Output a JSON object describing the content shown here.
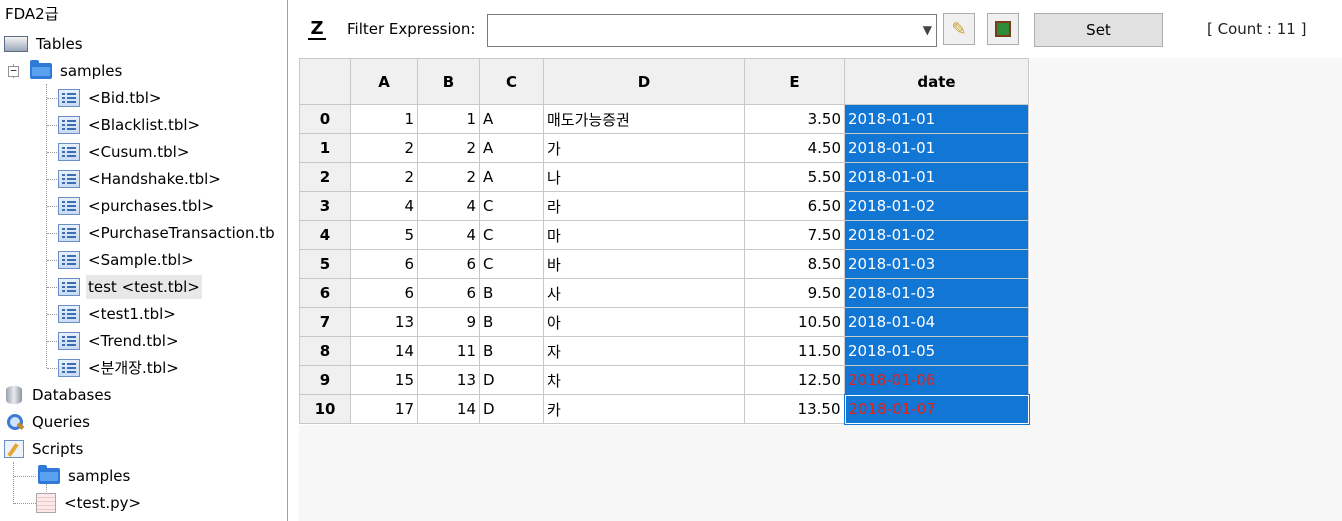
{
  "tree": {
    "root_label": "FDA2급",
    "tables_label": "Tables",
    "samples_label": "samples",
    "tables": [
      "<Bid.tbl>",
      "<Blacklist.tbl>",
      "<Cusum.tbl>",
      "<Handshake.tbl>",
      "<purchases.tbl>",
      "<PurchaseTransaction.tb",
      "<Sample.tbl>",
      "test <test.tbl>",
      "<test1.tbl>",
      "<Trend.tbl>",
      "<분개장.tbl>"
    ],
    "selected_index": 7,
    "databases_label": "Databases",
    "queries_label": "Queries",
    "scripts_label": "Scripts",
    "scripts_samples_label": "samples",
    "script_file": "<test.py>"
  },
  "toolbar": {
    "filter_label": "Filter Expression:",
    "filter_value": "",
    "set_label": "Set",
    "count_label": "[ Count : 11 ]"
  },
  "grid": {
    "columns": [
      "A",
      "B",
      "C",
      "D",
      "E",
      "date"
    ],
    "rows": [
      {
        "idx": "0",
        "A": "1",
        "B": "1",
        "C": "A",
        "D": "매도가능증권",
        "E": "3.50",
        "date": "2018-01-01",
        "red": false
      },
      {
        "idx": "1",
        "A": "2",
        "B": "2",
        "C": "A",
        "D": "가",
        "E": "4.50",
        "date": "2018-01-01",
        "red": false
      },
      {
        "idx": "2",
        "A": "2",
        "B": "2",
        "C": "A",
        "D": "나",
        "E": "5.50",
        "date": "2018-01-01",
        "red": false
      },
      {
        "idx": "3",
        "A": "4",
        "B": "4",
        "C": "C",
        "D": "라",
        "E": "6.50",
        "date": "2018-01-02",
        "red": false
      },
      {
        "idx": "4",
        "A": "5",
        "B": "4",
        "C": "C",
        "D": "마",
        "E": "7.50",
        "date": "2018-01-02",
        "red": false
      },
      {
        "idx": "5",
        "A": "6",
        "B": "6",
        "C": "C",
        "D": "바",
        "E": "8.50",
        "date": "2018-01-03",
        "red": false
      },
      {
        "idx": "6",
        "A": "6",
        "B": "6",
        "C": "B",
        "D": "사",
        "E": "9.50",
        "date": "2018-01-03",
        "red": false
      },
      {
        "idx": "7",
        "A": "13",
        "B": "9",
        "C": "B",
        "D": "아",
        "E": "10.50",
        "date": "2018-01-04",
        "red": false
      },
      {
        "idx": "8",
        "A": "14",
        "B": "11",
        "C": "B",
        "D": "자",
        "E": "11.50",
        "date": "2018-01-05",
        "red": false
      },
      {
        "idx": "9",
        "A": "15",
        "B": "13",
        "C": "D",
        "D": "차",
        "E": "12.50",
        "date": "2018-01-06",
        "red": true
      },
      {
        "idx": "10",
        "A": "17",
        "B": "14",
        "C": "D",
        "D": "카",
        "E": "13.50",
        "date": "2018-01-07",
        "red": true
      }
    ]
  },
  "colors": {
    "selection_blue": "#1176d4",
    "highlight_red": "#e2231a"
  }
}
